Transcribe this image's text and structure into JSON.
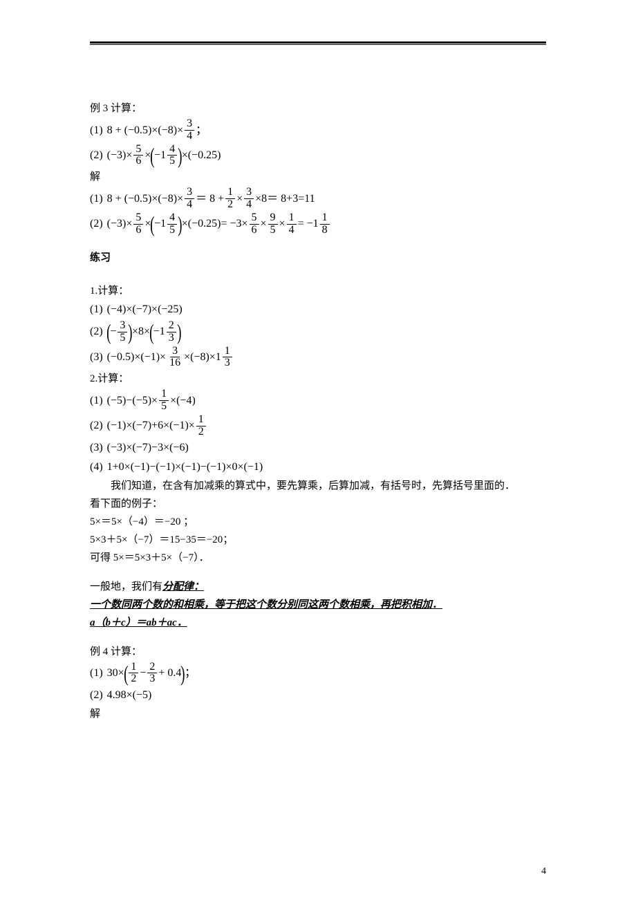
{
  "example3": {
    "title": "例 3 计算：",
    "item1_label": "(1)",
    "item1_part1": "8 + (−0.5)×(−8)×",
    "item1_frac_num": "3",
    "item1_frac_den": "4",
    "item1_tail": "；",
    "item2_label": "(2)",
    "item2_a": "(−3)×",
    "item2_f1n": "5",
    "item2_f1d": "6",
    "item2_b": "×",
    "item2_mix_whole": "−1",
    "item2_mix_n": "4",
    "item2_mix_d": "5",
    "item2_c": "×(−0.25)",
    "solve_label": "解",
    "sol1_label": "(1)",
    "sol1_a": "8 + (−0.5)×(−8)×",
    "sol1_f1n": "3",
    "sol1_f1d": "4",
    "sol1_eq": "＝ 8 +",
    "sol1_f2n": "1",
    "sol1_f2d": "2",
    "sol1_mid": "×",
    "sol1_f3n": "3",
    "sol1_f3d": "4",
    "sol1_tail": "×8＝ 8+3=11",
    "sol2_label": "(2)",
    "sol2_a": "(−3)×",
    "sol2_f1n": "5",
    "sol2_f1d": "6",
    "sol2_b": "×",
    "sol2_mix_whole": "−1",
    "sol2_mix_n": "4",
    "sol2_mix_d": "5",
    "sol2_c": "×(−0.25)= −3×",
    "sol2_f2n": "5",
    "sol2_f2d": "6",
    "sol2_d": "×",
    "sol2_f3n": "9",
    "sol2_f3d": "5",
    "sol2_e": "×",
    "sol2_f4n": "1",
    "sol2_f4d": "4",
    "sol2_f": "= −1",
    "sol2_f5n": "1",
    "sol2_f5d": "8"
  },
  "practice_title": "练习",
  "q1": {
    "title": "1.计算：",
    "i1_label": "(1)",
    "i1": "(−4)×(−7)×(−25)",
    "i2_label": "(2)",
    "i2_a_whole": "−",
    "i2_a_n": "3",
    "i2_a_d": "5",
    "i2_mid": "×8×",
    "i2_b_whole": "−1",
    "i2_b_n": "2",
    "i2_b_d": "3",
    "i3_label": "(3)",
    "i3_a": "(−0.5)×(−1)×",
    "i3_f1n": "3",
    "i3_f1d": "16",
    "i3_b": "×(−8)×1",
    "i3_f2n": "1",
    "i3_f2d": "3"
  },
  "q2": {
    "title": "2.计算：",
    "i1_label": "(1)",
    "i1_a": "(−5)−(−5)×",
    "i1_f1n": "1",
    "i1_f1d": "5",
    "i1_b": "×(−4)",
    "i2_label": "(2)",
    "i2_a": "(−1)×(−7)+6×(−1)×",
    "i2_f1n": "1",
    "i2_f1d": "2",
    "i3_label": "(3)",
    "i3": "(−3)×(−7)−3×(−6)",
    "i4_label": "(4)",
    "i4": "1+0×(−1)−(−1)×(−1)−(−1)×0×(−1)"
  },
  "text": {
    "p1": "我们知道，在含有加减乘的算式中，要先算乘，后算加减，有括号时，先算括号里面的．",
    "p2": "看下面的例子：",
    "p3": "5×＝5×（−4）＝−20 ；",
    "p4": "5×3＋5×（−7）＝15−35＝−20；",
    "p5": "可得 5×＝5×3＋5×（−7）．",
    "p6_a": "一般地，我们有",
    "p6_b": "分配律：",
    "p7": "一个数同两个数的和相乘，等于把这个数分别同这两个数相乘，再把积相加．",
    "p8": "a（b＋c）＝ab＋ac．"
  },
  "example4": {
    "title": " 例 4 计算：",
    "i1_label": "(1)",
    "i1_a": "30×",
    "i1_f1n": "1",
    "i1_f1d": "2",
    "i1_mid": "−",
    "i1_f2n": "2",
    "i1_f2d": "3",
    "i1_b": "+ 0.4",
    "i1_tail": "；",
    "i2_label": "(2)",
    "i2": "4.98×(−5)",
    "solve_label": "解"
  },
  "page_number": "4"
}
